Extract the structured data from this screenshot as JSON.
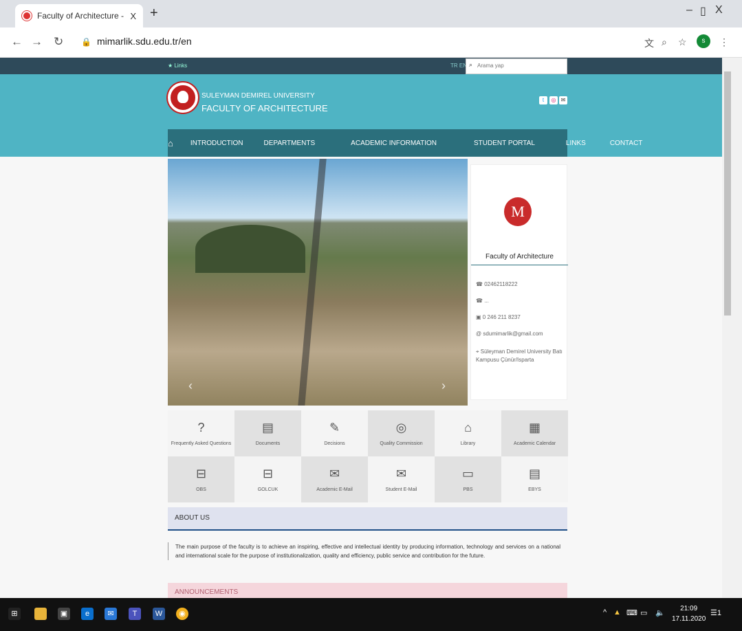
{
  "browser": {
    "tab_title": "Faculty of Architecture - Süleyma",
    "tab_close": "X",
    "new_tab": "+",
    "url": "mimarlik.sdu.edu.tr/en",
    "window_controls": [
      "–",
      "▯",
      "X"
    ],
    "avatar_letter": "s"
  },
  "site": {
    "links_label": "Links",
    "languages": "TR EN",
    "search_placeholder": "Arama yap",
    "university_name": "SULEYMAN DEMIREL UNIVERSITY",
    "faculty_name": "FACULTY OF ARCHITECTURE",
    "menu": [
      "INTRODUCTION",
      "DEPARTMENTS",
      "ACADEMIC INFORMATION",
      "STUDENT PORTAL",
      "LINKS",
      "CONTACT"
    ],
    "info": {
      "title": "Faculty of Architecture",
      "phone": "02462118222",
      "phone2": "...",
      "fax": "0 246 211 8237",
      "email": "sdumimarlik@gmail.com",
      "address": "Süleyman Demirel University Batı Kampusu Çünür/Isparta"
    },
    "quick_links": [
      {
        "label": "Frequently Asked Questions",
        "icon": "question-icon"
      },
      {
        "label": "Documents",
        "icon": "documents-icon"
      },
      {
        "label": "Decisions",
        "icon": "decisions-icon"
      },
      {
        "label": "Quality Commission",
        "icon": "quality-icon"
      },
      {
        "label": "Library",
        "icon": "library-icon"
      },
      {
        "label": "Academic Calendar",
        "icon": "calendar-icon"
      },
      {
        "label": "OBS",
        "icon": "obs-icon"
      },
      {
        "label": "GOLCUK",
        "icon": "golcuk-icon"
      },
      {
        "label": "Academic E-Mail",
        "icon": "academic-mail-icon"
      },
      {
        "label": "Student E-Mail",
        "icon": "student-mail-icon"
      },
      {
        "label": "PBS",
        "icon": "pbs-icon"
      },
      {
        "label": "EBYS",
        "icon": "ebys-icon"
      }
    ],
    "about_title": "ABOUT US",
    "about_text": "The main purpose of the faculty is to achieve an inspiring, effective and intellectual identity by producing information, technology and services on a national and international scale for the purpose of institutionalization, quality and efficiency, public service and contribution for the future.",
    "announcements_title": "ANNOUNCEMENTS"
  },
  "taskbar": {
    "time": "21:09",
    "date": "17.11.2020",
    "notifications": "1"
  }
}
